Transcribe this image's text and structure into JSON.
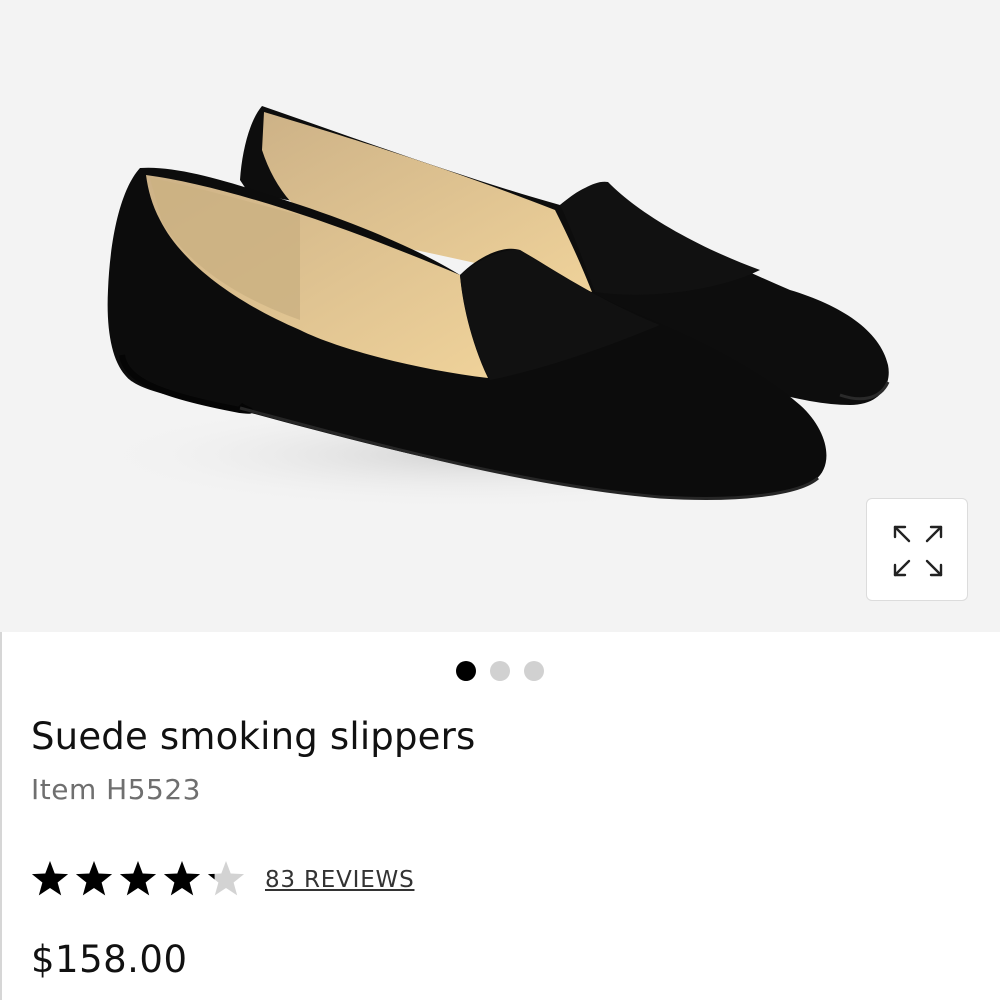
{
  "product": {
    "title": "Suede smoking slippers",
    "item_number": "Item H5523",
    "price": "$158.00",
    "rating": {
      "value": 4.2,
      "max": 5,
      "reviews_label": "83 REVIEWS"
    },
    "image": {
      "subject": "pair of black suede smoking slippers",
      "icon": "expand-arrows-icon"
    }
  },
  "carousel": {
    "count": 3,
    "active_index": 0
  },
  "colors": {
    "image_background": "#f3f3f3",
    "star_filled": "#000000",
    "star_empty": "#d3d3d3",
    "dot_active": "#000000",
    "dot_inactive": "#d1d1d1",
    "suede": "#0c0c0c",
    "lining": "#e4c78c"
  }
}
